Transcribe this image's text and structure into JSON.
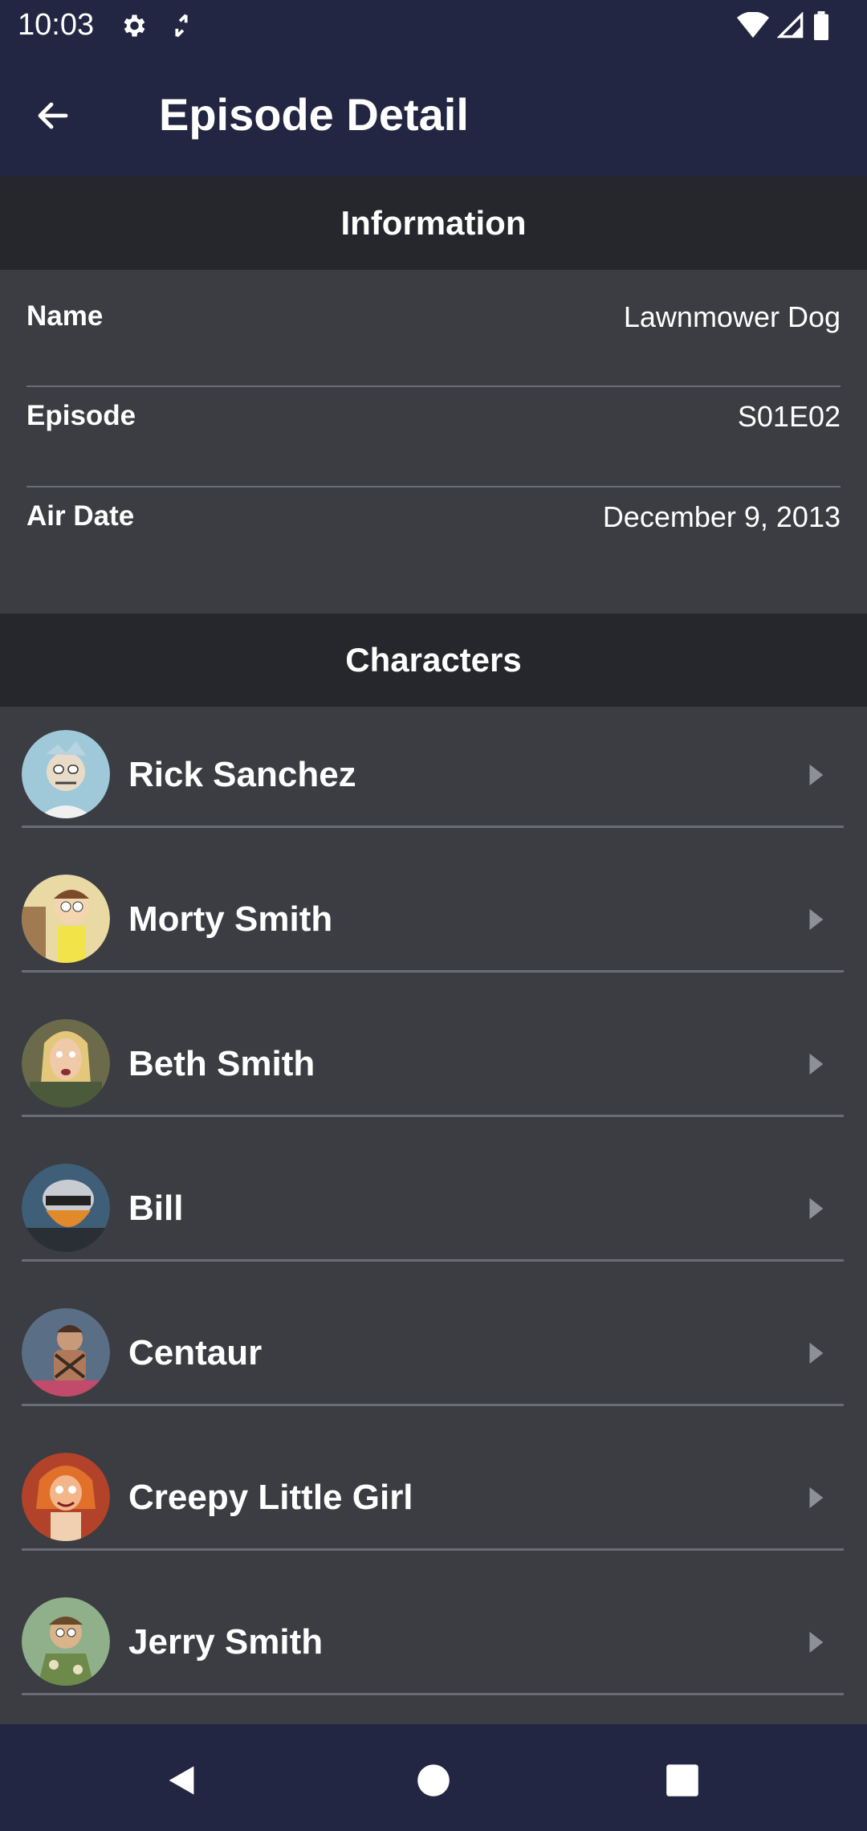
{
  "status_bar": {
    "time": "10:03",
    "left_icons": [
      "gear-icon",
      "sync-icon"
    ],
    "right_icons": [
      "wifi-icon",
      "signal-icon",
      "battery-icon"
    ]
  },
  "app_bar": {
    "title": "Episode Detail",
    "back_icon": "arrow-back-icon"
  },
  "information": {
    "header": "Information",
    "rows": [
      {
        "label": "Name",
        "value": "Lawnmower Dog"
      },
      {
        "label": "Episode",
        "value": "S01E02"
      },
      {
        "label": "Air Date",
        "value": "December 9, 2013"
      }
    ]
  },
  "characters": {
    "header": "Characters",
    "items": [
      {
        "name": "Rick Sanchez",
        "avatar_color": "#9fc9d8"
      },
      {
        "name": "Morty Smith",
        "avatar_color": "#e9d9a4"
      },
      {
        "name": "Beth Smith",
        "avatar_color": "#6b6a4a"
      },
      {
        "name": "Bill",
        "avatar_color": "#3f5f78"
      },
      {
        "name": "Centaur",
        "avatar_color": "#5a6f86"
      },
      {
        "name": "Creepy Little Girl",
        "avatar_color": "#b2432a"
      },
      {
        "name": "Jerry Smith",
        "avatar_color": "#8fb08a"
      }
    ]
  },
  "nav_bar": {
    "buttons": [
      "back-triangle-icon",
      "home-circle-icon",
      "recents-square-icon"
    ]
  },
  "colors": {
    "app_bar": "#232642",
    "section_header": "#25272c",
    "background": "#3b3d42",
    "divider": "#6a6d73"
  }
}
